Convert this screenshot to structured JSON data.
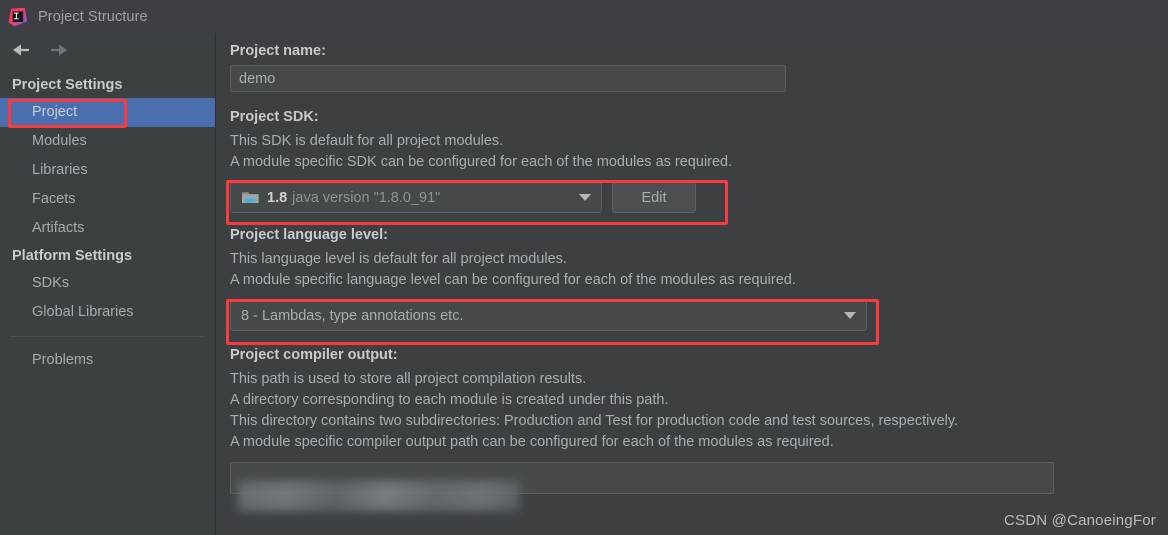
{
  "window": {
    "title": "Project Structure",
    "app_icon": "intellij-idea-logo"
  },
  "nav": {
    "back_icon": "arrow-left-icon",
    "forward_icon": "arrow-right-icon"
  },
  "sidebar": {
    "groups": [
      {
        "label": "Project Settings",
        "items": [
          {
            "label": "Project",
            "selected": true
          },
          {
            "label": "Modules",
            "selected": false
          },
          {
            "label": "Libraries",
            "selected": false
          },
          {
            "label": "Facets",
            "selected": false
          },
          {
            "label": "Artifacts",
            "selected": false
          }
        ]
      },
      {
        "label": "Platform Settings",
        "items": [
          {
            "label": "SDKs",
            "selected": false
          },
          {
            "label": "Global Libraries",
            "selected": false
          }
        ]
      }
    ],
    "extra_items": [
      {
        "label": "Problems"
      }
    ]
  },
  "main": {
    "project_name": {
      "label": "Project name:",
      "value": "demo"
    },
    "project_sdk": {
      "label": "Project SDK:",
      "description": [
        "This SDK is default for all project modules.",
        "A module specific SDK can be configured for each of the modules as required."
      ],
      "sdk_icon": "java-sdk-folder-icon",
      "version": "1.8",
      "version_detail": "java version \"1.8.0_91\"",
      "dropdown_icon": "chevron-down-icon",
      "edit_label": "Edit"
    },
    "language_level": {
      "label": "Project language level:",
      "description": [
        "This language level is default for all project modules.",
        "A module specific language level can be configured for each of the modules as required."
      ],
      "value": "8 - Lambdas, type annotations etc.",
      "dropdown_icon": "chevron-down-icon"
    },
    "compiler_output": {
      "label": "Project compiler output:",
      "description": [
        "This path is used to store all project compilation results.",
        "A directory corresponding to each module is created under this path.",
        "This directory contains two subdirectories: Production and Test for production code and test sources, respectively.",
        "A module specific compiler output path can be configured for each of the modules as required."
      ],
      "value": "",
      "browse_icon": "folder-open-icon"
    }
  },
  "annotations": {
    "highlight_color": "#fb3b3b",
    "boxes": [
      {
        "name": "highlight-project-sidebar-item"
      },
      {
        "name": "highlight-project-sdk-row"
      },
      {
        "name": "highlight-language-level-row"
      }
    ]
  },
  "watermark": {
    "text": "CSDN @CanoeingFor"
  },
  "theme": {
    "background": "#3c4043",
    "sidebar_background": "#3b4043",
    "selection_blue": "#4b6eaf",
    "accent_red": "#fb3b3b"
  }
}
